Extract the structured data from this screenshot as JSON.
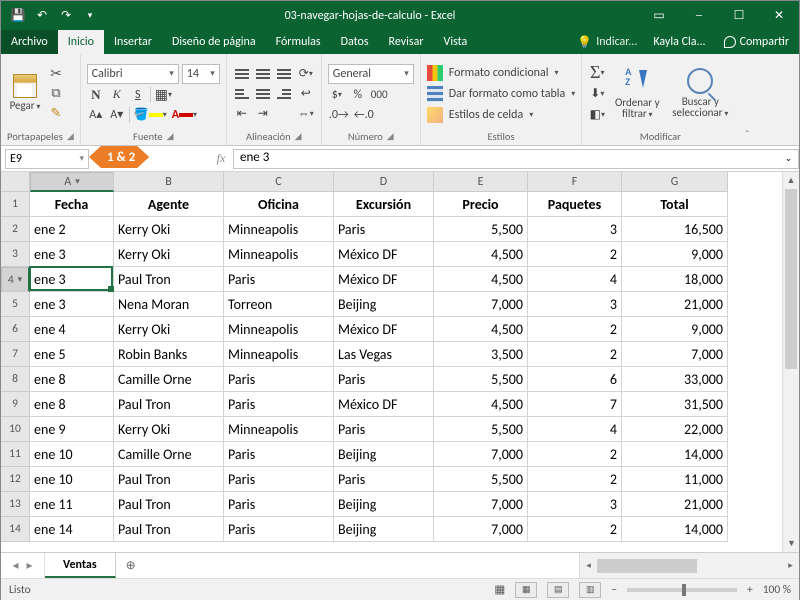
{
  "app": {
    "title": "03-navegar-hojas-de-calculo - Excel"
  },
  "menu": {
    "file": "Archivo",
    "home": "Inicio",
    "insert": "Insertar",
    "layout": "Diseño de página",
    "formulas": "Fórmulas",
    "data": "Datos",
    "review": "Revisar",
    "view": "Vista",
    "tell": "Indicar...",
    "user": "Kayla Cla...",
    "share": "Compartir"
  },
  "ribbon": {
    "clipboard": {
      "label": "Portapapeles",
      "paste": "Pegar"
    },
    "font": {
      "label": "Fuente",
      "name": "Calibri",
      "size": "14",
      "bold": "N",
      "italic": "K",
      "underline": "S"
    },
    "align": {
      "label": "Alineación"
    },
    "number": {
      "label": "Número",
      "format": "General"
    },
    "styles": {
      "label": "Estilos",
      "cond": "Formato condicional",
      "table": "Dar formato como tabla",
      "cell": "Estilos de celda"
    },
    "editing": {
      "label": "Modificar",
      "sort": "Ordenar y filtrar",
      "find": "Buscar y seleccionar"
    }
  },
  "formulabar": {
    "namebox": "E9",
    "tag": "1 & 2",
    "fx": "fx",
    "value": "ene 3"
  },
  "grid": {
    "cols": [
      "A",
      "B",
      "C",
      "D",
      "E",
      "F",
      "G"
    ],
    "widths": [
      84,
      110,
      110,
      100,
      94,
      94,
      106
    ],
    "selectedCol": 0,
    "selectedRow": 4,
    "headers": [
      "Fecha",
      "Agente",
      "Oficina",
      "Excursión",
      "Precio",
      "Paquetes",
      "Total"
    ],
    "rows": [
      [
        "ene 2",
        "Kerry Oki",
        "Minneapolis",
        "Paris",
        "5,500",
        "3",
        "16,500"
      ],
      [
        "ene 3",
        "Kerry Oki",
        "Minneapolis",
        "México DF",
        "4,500",
        "2",
        "9,000"
      ],
      [
        "ene 3",
        "Paul Tron",
        "Paris",
        "México DF",
        "4,500",
        "4",
        "18,000"
      ],
      [
        "ene 3",
        "Nena Moran",
        "Torreon",
        "Beijing",
        "7,000",
        "3",
        "21,000"
      ],
      [
        "ene 4",
        "Kerry Oki",
        "Minneapolis",
        "México DF",
        "4,500",
        "2",
        "9,000"
      ],
      [
        "ene 5",
        "Robin Banks",
        "Minneapolis",
        "Las Vegas",
        "3,500",
        "2",
        "7,000"
      ],
      [
        "ene 8",
        "Camille Orne",
        "Paris",
        "Paris",
        "5,500",
        "6",
        "33,000"
      ],
      [
        "ene 8",
        "Paul Tron",
        "Paris",
        "México DF",
        "4,500",
        "7",
        "31,500"
      ],
      [
        "ene 9",
        "Kerry Oki",
        "Minneapolis",
        "Paris",
        "5,500",
        "4",
        "22,000"
      ],
      [
        "ene 10",
        "Camille Orne",
        "Paris",
        "Beijing",
        "7,000",
        "2",
        "14,000"
      ],
      [
        "ene 10",
        "Paul Tron",
        "Paris",
        "Paris",
        "5,500",
        "2",
        "11,000"
      ],
      [
        "ene 11",
        "Paul Tron",
        "Paris",
        "Beijing",
        "7,000",
        "3",
        "21,000"
      ],
      [
        "ene 14",
        "Paul Tron",
        "Paris",
        "Beijing",
        "7,000",
        "2",
        "14,000"
      ]
    ]
  },
  "sheets": {
    "active": "Ventas"
  },
  "status": {
    "ready": "Listo",
    "zoom": "100 %"
  }
}
